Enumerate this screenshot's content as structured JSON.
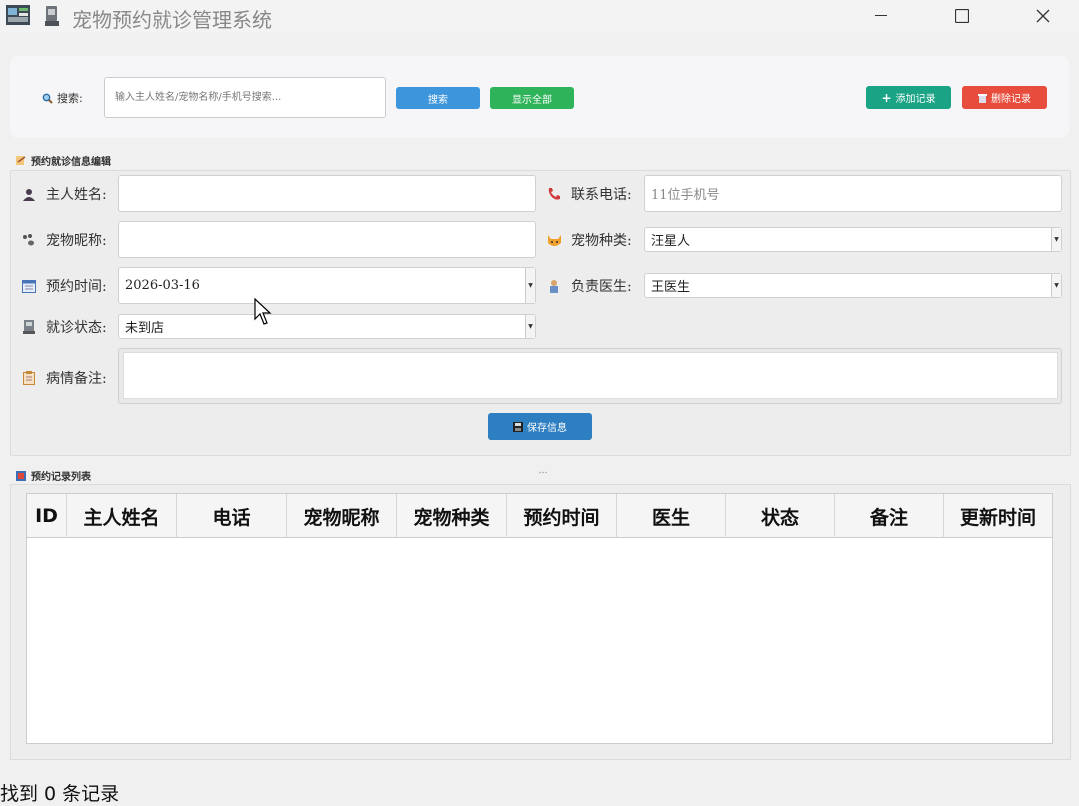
{
  "window": {
    "title": "宠物预约就诊管理系统",
    "controls": {
      "minimize": "─",
      "maximize": "☐",
      "close": "✕"
    }
  },
  "search": {
    "label": "搜索:",
    "placeholder": "输入主人姓名/宠物名称/手机号搜索...",
    "search_button": "搜索",
    "show_all_button": "显示全部",
    "add_button": "添加记录",
    "delete_button": "删除记录"
  },
  "form": {
    "section_title": "预约就诊信息编辑",
    "owner_name_label": "主人姓名:",
    "owner_name_value": "",
    "phone_label": "联系电话:",
    "phone_placeholder": "11位手机号",
    "pet_name_label": "宠物昵称:",
    "pet_name_value": "",
    "pet_type_label": "宠物种类:",
    "pet_type_value": "汪星人",
    "appointment_time_label": "预约时间:",
    "appointment_time_value": "2026-03-16",
    "doctor_label": "负责医生:",
    "doctor_value": "王医生",
    "status_label": "就诊状态:",
    "status_value": "未到店",
    "notes_label": "病情备注:",
    "notes_value": "",
    "save_button": "保存信息"
  },
  "table": {
    "section_title": "预约记录列表",
    "columns": [
      "ID",
      "主人姓名",
      "电话",
      "宠物昵称",
      "宠物种类",
      "预约时间",
      "医生",
      "状态",
      "备注",
      "更新时间"
    ],
    "rows": []
  },
  "status_bar": {
    "text": "找到 0 条记录"
  },
  "colors": {
    "search_button": "#3d95dc",
    "show_all_button": "#2fb35a",
    "add_button": "#1aa384",
    "delete_button": "#e74c3c",
    "save_button": "#2e7fc2"
  }
}
